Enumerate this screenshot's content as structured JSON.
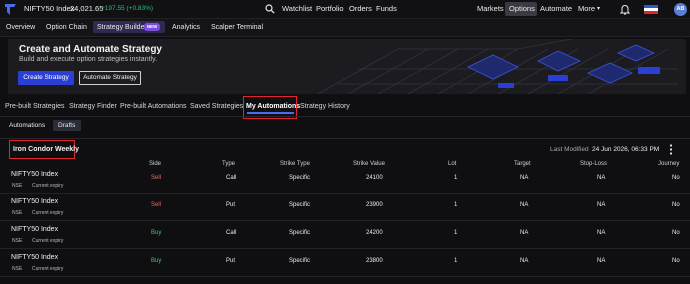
{
  "topbar": {
    "symbol": "NIFTY50 Index",
    "price": "24,021.65",
    "change": "+197.55 (+0.83%)",
    "links": [
      "Watchlist",
      "Portfolio",
      "Orders",
      "Funds"
    ],
    "right_links": [
      "Markets",
      "Options",
      "Automate",
      "More"
    ],
    "more_arrow": "▾",
    "active_right": "Options",
    "avatar": "AB"
  },
  "subnav": {
    "items": [
      "Overview",
      "Option Chain",
      "Strategy Builder",
      "Analytics",
      "Scalper Terminal"
    ],
    "active": "Strategy Builder",
    "badge": "NEW"
  },
  "banner": {
    "title": "Create and Automate Strategy",
    "subtitle": "Build and execute option strategies instantly.",
    "primary_button": "Create Strategy",
    "secondary_button": "Automate Strategy"
  },
  "tabs": {
    "items": [
      "Pre-built Strategies",
      "Strategy Finder",
      "Pre-built Automations",
      "Saved Strategies",
      "My Automations",
      "Strategy History"
    ],
    "active": "My Automations"
  },
  "subtabs": {
    "items": [
      "Automations",
      "Drafts"
    ],
    "active": "Drafts"
  },
  "strategy": {
    "name": "Iron Condor Weekly",
    "last_modified_label": "Last Modified",
    "last_modified_value": "24 Jun 2026, 06:33 PM"
  },
  "table": {
    "headers": [
      "Side",
      "Type",
      "Strike Type",
      "Strike Value",
      "Lot",
      "Target",
      "Stop-Loss",
      "Journey"
    ],
    "rows": [
      {
        "instrument": "NIFTY50 Index",
        "exchange": "NSE",
        "expiry": "Current expiry",
        "side": "Sell",
        "type": "Call",
        "strike_type": "Specific",
        "strike_value": "24100",
        "lot": "1",
        "target": "NA",
        "stop_loss": "NA",
        "journey": "No"
      },
      {
        "instrument": "NIFTY50 Index",
        "exchange": "NSE",
        "expiry": "Current expiry",
        "side": "Sell",
        "type": "Put",
        "strike_type": "Specific",
        "strike_value": "23900",
        "lot": "1",
        "target": "NA",
        "stop_loss": "NA",
        "journey": "No"
      },
      {
        "instrument": "NIFTY50 Index",
        "exchange": "NSE",
        "expiry": "Current expiry",
        "side": "Buy",
        "type": "Call",
        "strike_type": "Specific",
        "strike_value": "24200",
        "lot": "1",
        "target": "NA",
        "stop_loss": "NA",
        "journey": "No"
      },
      {
        "instrument": "NIFTY50 Index",
        "exchange": "NSE",
        "expiry": "Current expiry",
        "side": "Buy",
        "type": "Put",
        "strike_type": "Specific",
        "strike_value": "23800",
        "lot": "1",
        "target": "NA",
        "stop_loss": "NA",
        "journey": "No"
      }
    ]
  },
  "colors": {
    "sell": "#f06a5e",
    "buy": "#3fc97a",
    "accent": "#2a3fd6",
    "highlight_box": "#e1252b",
    "positive": "#26c281"
  },
  "icons": [
    "logo-icon",
    "search-icon",
    "bell-icon",
    "flag-icon",
    "kebab-menu-icon"
  ]
}
